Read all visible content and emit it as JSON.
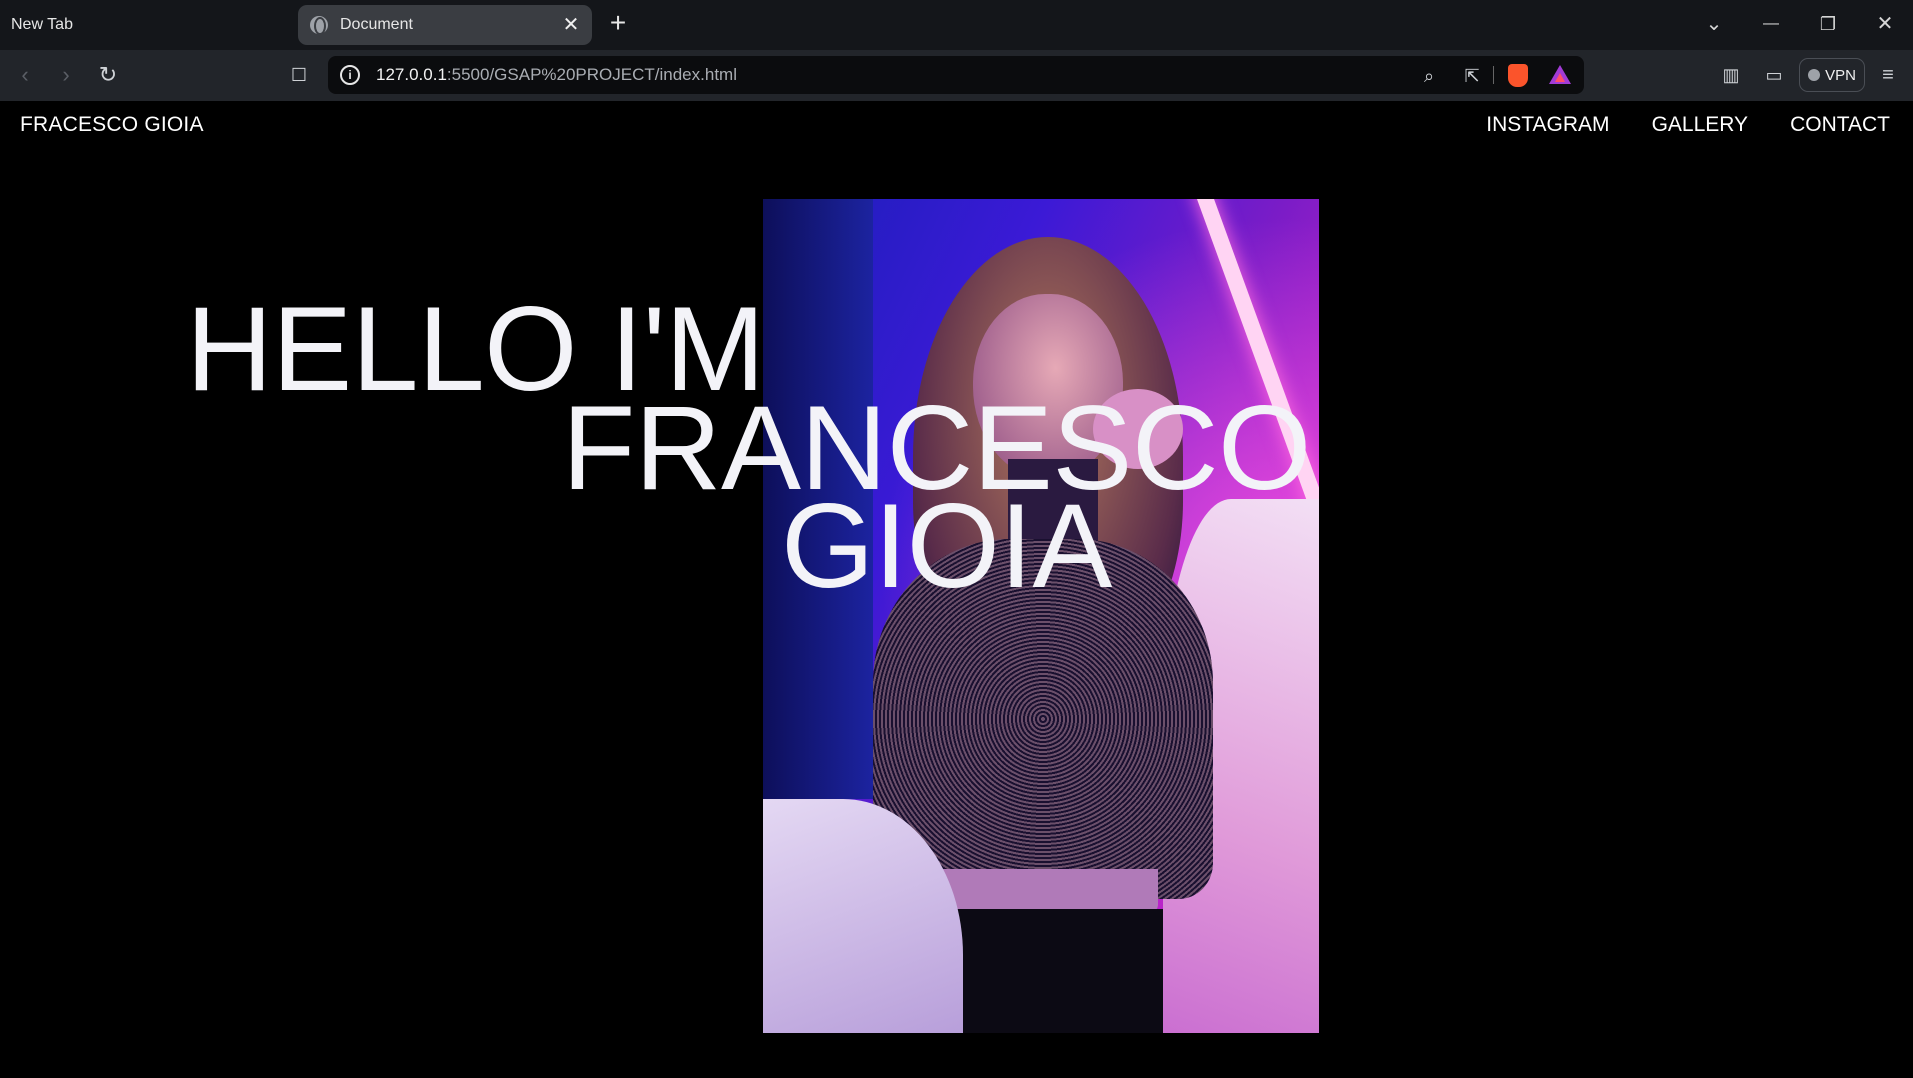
{
  "browser": {
    "tabs": [
      {
        "title": "New Tab",
        "active": false
      },
      {
        "title": "Document",
        "active": true
      }
    ],
    "close_tab_glyph": "✕",
    "new_tab_glyph": "+",
    "url_host": "127.0.0.1",
    "url_rest": ":5500/GSAP%20PROJECT/index.html",
    "vpn_label": "VPN",
    "window_controls": {
      "tab_search": "⌄",
      "minimize": "—",
      "restore": "❐",
      "close": "✕"
    }
  },
  "site": {
    "brand": "FRACESCO GIOIA",
    "nav": [
      "INSTAGRAM",
      "GALLERY",
      "CONTACT"
    ],
    "headline": [
      "HELLO I'M",
      "FRANCESCO",
      "GIOIA"
    ],
    "hero_image": "portrait-photo"
  },
  "colors": {
    "page_bg": "#000000",
    "text": "#ffffff",
    "chrome_tabstrip": "#14161a",
    "chrome_toolbar": "#22252a",
    "omnibox": "#0b0c0e"
  }
}
